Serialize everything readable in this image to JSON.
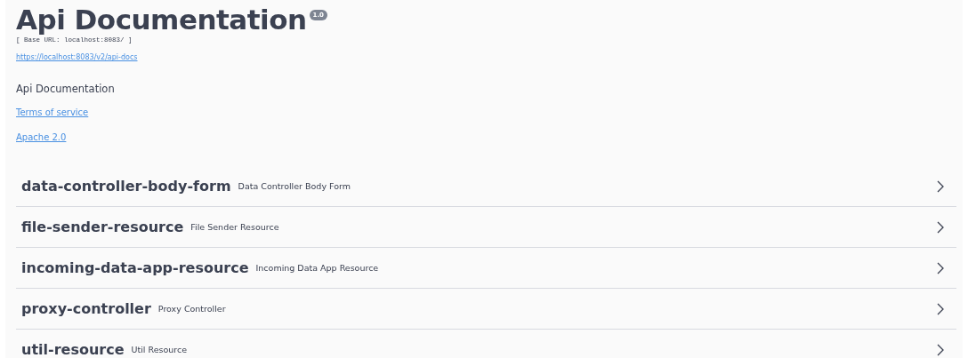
{
  "info": {
    "title": "Api Documentation",
    "version": "1.0",
    "base_url": "[ Base URL: localhost:8083/ ]",
    "spec_url": "https://localhost:8083/v2/api-docs",
    "description": "Api Documentation",
    "links": [
      "Terms of service",
      "Apache 2.0"
    ]
  },
  "tags": [
    {
      "name": "data-controller-body-form",
      "description": "Data Controller Body Form"
    },
    {
      "name": "file-sender-resource",
      "description": "File Sender Resource"
    },
    {
      "name": "incoming-data-app-resource",
      "description": "Incoming Data App Resource"
    },
    {
      "name": "proxy-controller",
      "description": "Proxy Controller"
    },
    {
      "name": "util-resource",
      "description": "Util Resource"
    }
  ]
}
